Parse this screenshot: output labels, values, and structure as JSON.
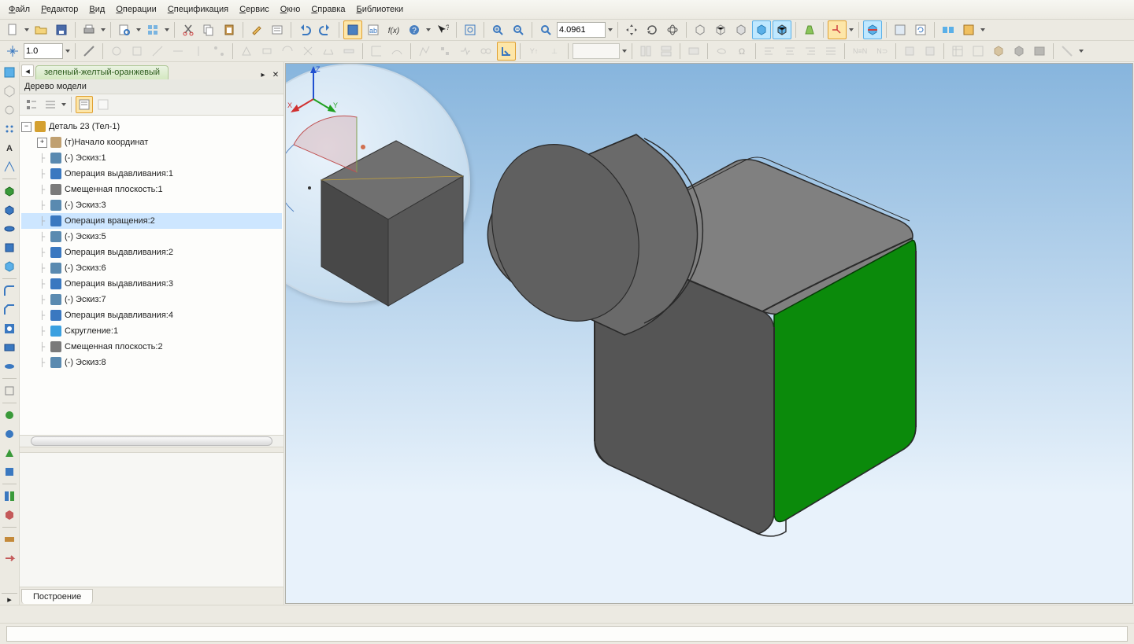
{
  "menu": [
    "Файл",
    "Редактор",
    "Вид",
    "Операции",
    "Спецификация",
    "Сервис",
    "Окно",
    "Справка",
    "Библиотеки"
  ],
  "menu_ul": [
    0,
    0,
    0,
    0,
    0,
    0,
    0,
    0,
    0
  ],
  "toolbar1": {
    "zoom_value": "4.0961"
  },
  "toolbar2": {
    "size_value": "1.0"
  },
  "document_tab": "зеленый-желтый-оранжевый",
  "panel_title": "Дерево модели",
  "tree_root": "Деталь 23 (Тел-1)",
  "tree_items": [
    {
      "label": "(т)Начало координат",
      "icon": "#c0a070",
      "exp": "+",
      "depth": 1
    },
    {
      "label": "(-) Эскиз:1",
      "icon": "#5a8ab0",
      "depth": 1
    },
    {
      "label": "Операция выдавливания:1",
      "icon": "#3a78c0",
      "depth": 1
    },
    {
      "label": "Смещенная плоскость:1",
      "icon": "#7a7a7a",
      "depth": 1
    },
    {
      "label": "(-) Эскиз:3",
      "icon": "#5a8ab0",
      "depth": 1
    },
    {
      "label": "Операция вращения:2",
      "icon": "#3a78c0",
      "depth": 1,
      "sel": true
    },
    {
      "label": "(-) Эскиз:5",
      "icon": "#5a8ab0",
      "depth": 1
    },
    {
      "label": "Операция выдавливания:2",
      "icon": "#3a78c0",
      "depth": 1
    },
    {
      "label": "(-) Эскиз:6",
      "icon": "#5a8ab0",
      "depth": 1
    },
    {
      "label": "Операция выдавливания:3",
      "icon": "#3a78c0",
      "depth": 1
    },
    {
      "label": "(-) Эскиз:7",
      "icon": "#5a8ab0",
      "depth": 1
    },
    {
      "label": "Операция выдавливания:4",
      "icon": "#3a78c0",
      "depth": 1
    },
    {
      "label": "Скругление:1",
      "icon": "#3aa0e0",
      "depth": 1
    },
    {
      "label": "Смещенная плоскость:2",
      "icon": "#7a7a7a",
      "depth": 1
    },
    {
      "label": "(-) Эскиз:8",
      "icon": "#5a8ab0",
      "depth": 1
    }
  ],
  "bottom_tab": "Построение",
  "triad": {
    "x": "X",
    "y": "Y",
    "z": "Z"
  },
  "colors": {
    "face_green": "#0b8a0b",
    "body_grey": "#606060",
    "body_top": "#808080",
    "body_left": "#505050"
  }
}
